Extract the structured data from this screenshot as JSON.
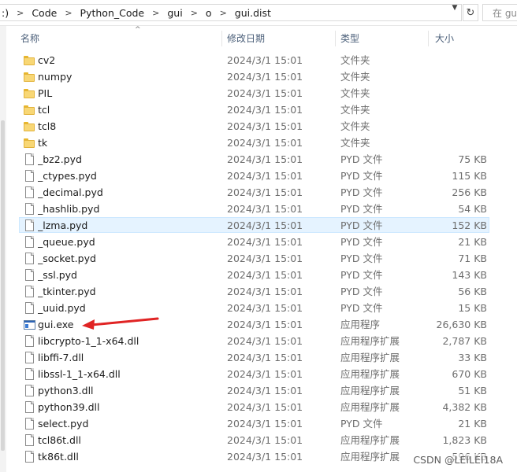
{
  "address": {
    "crumbs": [
      ":)",
      "Code",
      "Python_Code",
      "gui",
      "o",
      "gui.dist"
    ],
    "separator": ">",
    "dropdown_icon": "chevron-down-icon",
    "refresh_icon": "refresh-icon"
  },
  "search": {
    "placeholder": "在 gu"
  },
  "columns": {
    "name": "名称",
    "date": "修改日期",
    "type": "类型",
    "size": "大小"
  },
  "sort": {
    "column": "name",
    "direction": "ascending",
    "arrow": "^"
  },
  "files": [
    {
      "name": "cv2",
      "date": "2024/3/1 15:01",
      "type": "文件夹",
      "size": "",
      "kind": "folder"
    },
    {
      "name": "numpy",
      "date": "2024/3/1 15:01",
      "type": "文件夹",
      "size": "",
      "kind": "folder"
    },
    {
      "name": "PIL",
      "date": "2024/3/1 15:01",
      "type": "文件夹",
      "size": "",
      "kind": "folder"
    },
    {
      "name": "tcl",
      "date": "2024/3/1 15:01",
      "type": "文件夹",
      "size": "",
      "kind": "folder"
    },
    {
      "name": "tcl8",
      "date": "2024/3/1 15:01",
      "type": "文件夹",
      "size": "",
      "kind": "folder"
    },
    {
      "name": "tk",
      "date": "2024/3/1 15:01",
      "type": "文件夹",
      "size": "",
      "kind": "folder"
    },
    {
      "name": "_bz2.pyd",
      "date": "2024/3/1 15:01",
      "type": "PYD 文件",
      "size": "75 KB",
      "kind": "file"
    },
    {
      "name": "_ctypes.pyd",
      "date": "2024/3/1 15:01",
      "type": "PYD 文件",
      "size": "115 KB",
      "kind": "file"
    },
    {
      "name": "_decimal.pyd",
      "date": "2024/3/1 15:01",
      "type": "PYD 文件",
      "size": "256 KB",
      "kind": "file"
    },
    {
      "name": "_hashlib.pyd",
      "date": "2024/3/1 15:01",
      "type": "PYD 文件",
      "size": "54 KB",
      "kind": "file"
    },
    {
      "name": "_lzma.pyd",
      "date": "2024/3/1 15:01",
      "type": "PYD 文件",
      "size": "152 KB",
      "kind": "file",
      "selected": true
    },
    {
      "name": "_queue.pyd",
      "date": "2024/3/1 15:01",
      "type": "PYD 文件",
      "size": "21 KB",
      "kind": "file"
    },
    {
      "name": "_socket.pyd",
      "date": "2024/3/1 15:01",
      "type": "PYD 文件",
      "size": "71 KB",
      "kind": "file"
    },
    {
      "name": "_ssl.pyd",
      "date": "2024/3/1 15:01",
      "type": "PYD 文件",
      "size": "143 KB",
      "kind": "file"
    },
    {
      "name": "_tkinter.pyd",
      "date": "2024/3/1 15:01",
      "type": "PYD 文件",
      "size": "56 KB",
      "kind": "file"
    },
    {
      "name": "_uuid.pyd",
      "date": "2024/3/1 15:01",
      "type": "PYD 文件",
      "size": "15 KB",
      "kind": "file"
    },
    {
      "name": "gui.exe",
      "date": "2024/3/1 15:01",
      "type": "应用程序",
      "size": "26,630 KB",
      "kind": "exe"
    },
    {
      "name": "libcrypto-1_1-x64.dll",
      "date": "2024/3/1 15:01",
      "type": "应用程序扩展",
      "size": "2,787 KB",
      "kind": "file"
    },
    {
      "name": "libffi-7.dll",
      "date": "2024/3/1 15:01",
      "type": "应用程序扩展",
      "size": "33 KB",
      "kind": "file"
    },
    {
      "name": "libssl-1_1-x64.dll",
      "date": "2024/3/1 15:01",
      "type": "应用程序扩展",
      "size": "670 KB",
      "kind": "file"
    },
    {
      "name": "python3.dll",
      "date": "2024/3/1 15:01",
      "type": "应用程序扩展",
      "size": "51 KB",
      "kind": "file"
    },
    {
      "name": "python39.dll",
      "date": "2024/3/1 15:01",
      "type": "应用程序扩展",
      "size": "4,382 KB",
      "kind": "file"
    },
    {
      "name": "select.pyd",
      "date": "2024/3/1 15:01",
      "type": "PYD 文件",
      "size": "21 KB",
      "kind": "file"
    },
    {
      "name": "tcl86t.dll",
      "date": "2024/3/1 15:01",
      "type": "应用程序扩展",
      "size": "1,823 KB",
      "kind": "file"
    },
    {
      "name": "tk86t.dll",
      "date": "2024/3/1 15:01",
      "type": "应用程序扩展",
      "size": "596 KB",
      "kind": "file"
    }
  ],
  "annotation": {
    "target": "gui.exe",
    "color": "#e02424",
    "icon": "red-arrow-icon"
  },
  "watermark": "CSDN @LEILEI18A",
  "colors": {
    "header_text": "#4c607a",
    "folder": "#f8d775",
    "selection": "#e5f3ff",
    "selection_border": "#cce8ff"
  }
}
